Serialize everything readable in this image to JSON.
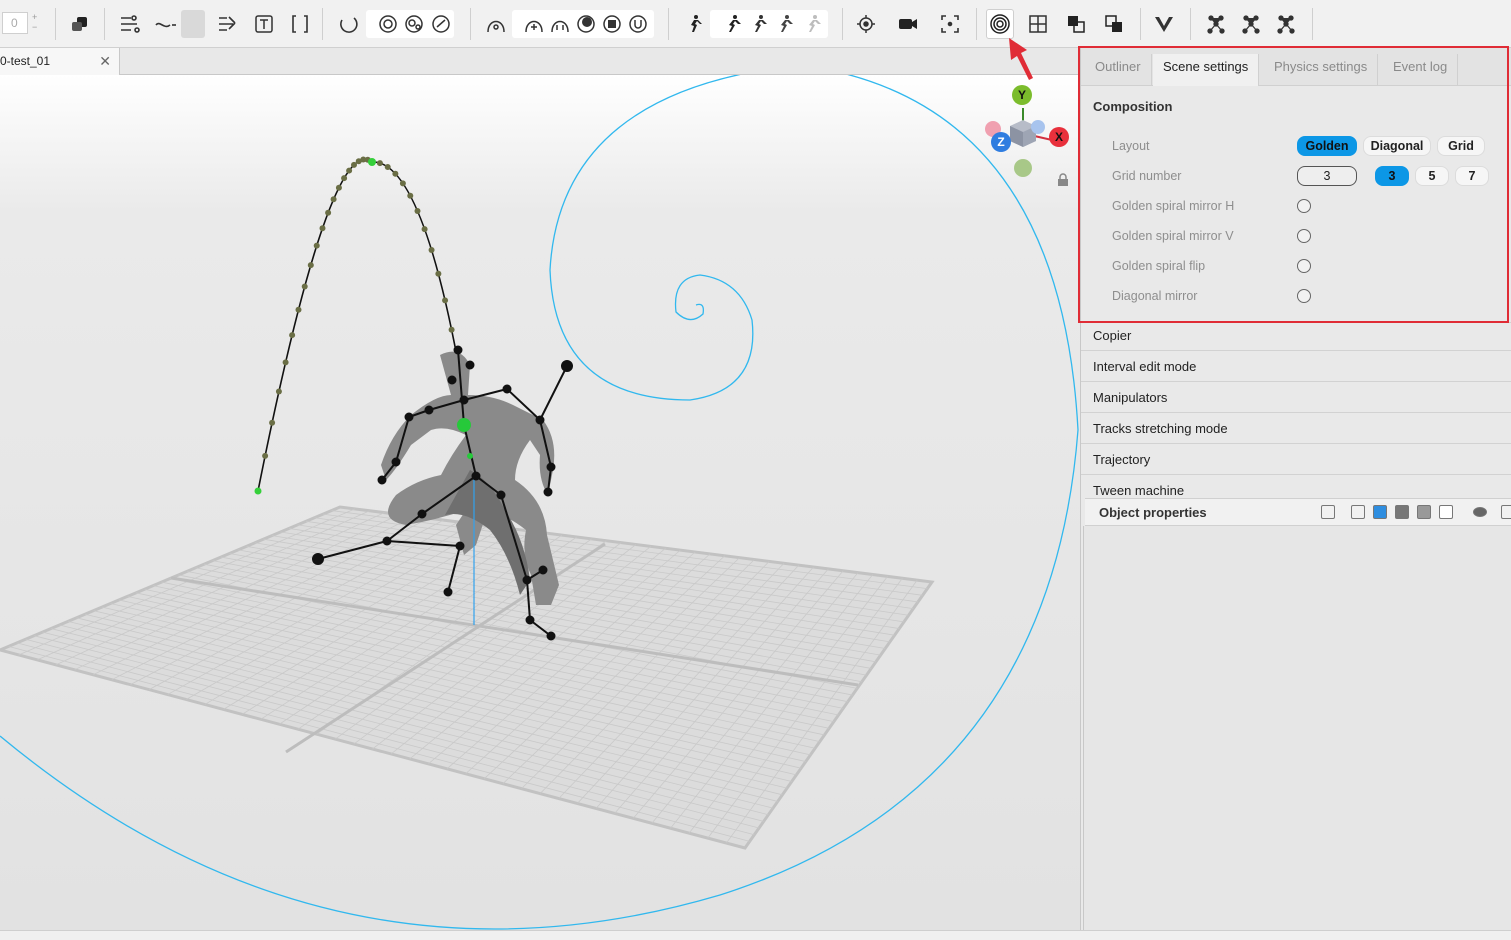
{
  "toolbar": {
    "frame_value": "0",
    "icons": [
      "selection-icon",
      "curve-edit-icon",
      "interpolation-icon",
      "sparse-edit-icon",
      "text-icon",
      "bracket-icon",
      "undo-circle-icon",
      "physics-icon",
      "ghost-icon",
      "loop-icon",
      "arc-icon",
      "add-arc-icon",
      "magnet-icon",
      "record-icon",
      "stop-icon",
      "repeat-icon",
      "walk-icon",
      "run-icon",
      "auto-pose-icon",
      "pose-ik-icon",
      "pose-disabled-icon",
      "target-icon",
      "camera-icon",
      "frame-fit-icon",
      "golden-spiral-icon",
      "grid-icon",
      "layers-icon",
      "layers-alt-icon",
      "v-icon",
      "joints-icon",
      "joints-alt-icon",
      "joints-more-icon"
    ]
  },
  "doc_tab": {
    "title": "0-test_01",
    "close": "✕"
  },
  "panel": {
    "tabs": [
      {
        "label": "Outliner",
        "active": false
      },
      {
        "label": "Scene settings",
        "active": true
      },
      {
        "label": "Physics settings",
        "active": false
      },
      {
        "label": "Event log",
        "active": false
      }
    ],
    "composition": {
      "title": "Composition",
      "layout_label": "Layout",
      "layout_options": [
        "Golden",
        "Diagonal",
        "Grid"
      ],
      "layout_selected": "Golden",
      "grid_number_label": "Grid number",
      "grid_number_value": "3",
      "grid_options": [
        "3",
        "5",
        "7"
      ],
      "grid_selected": "3",
      "toggles": [
        "Golden spiral mirror H",
        "Golden spiral mirror V",
        "Golden spiral flip",
        "Diagonal mirror"
      ]
    },
    "sections": [
      "Copier",
      "Interval edit mode",
      "Manipulators",
      "Tracks stretching mode",
      "Trajectory",
      "Tween machine"
    ],
    "object_properties": {
      "title": "Object properties"
    }
  },
  "gizmo": {
    "y": "Y",
    "x": "X",
    "z": "Z"
  },
  "colors": {
    "accent": "#0c97e6",
    "highlight": "#e02c36",
    "spiral": "#31b8ee",
    "trajectory_point": "#6a6e45"
  }
}
